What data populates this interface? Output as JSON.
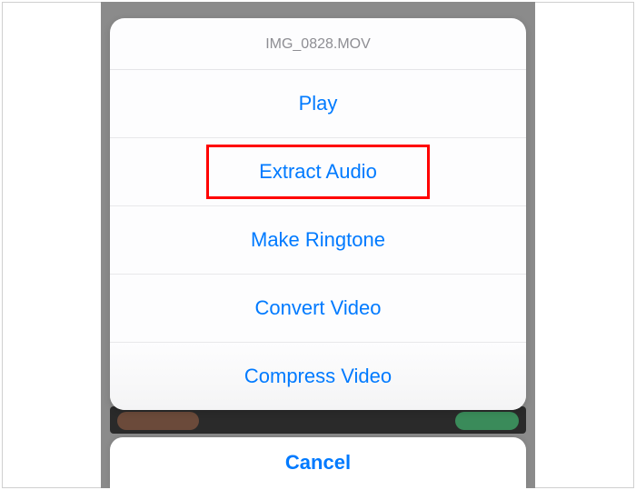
{
  "sheet": {
    "title": "IMG_0828.MOV",
    "options": [
      {
        "label": "Play"
      },
      {
        "label": "Extract Audio",
        "highlighted": true
      },
      {
        "label": "Make Ringtone"
      },
      {
        "label": "Convert Video"
      },
      {
        "label": "Compress Video"
      }
    ],
    "cancel_label": "Cancel"
  }
}
